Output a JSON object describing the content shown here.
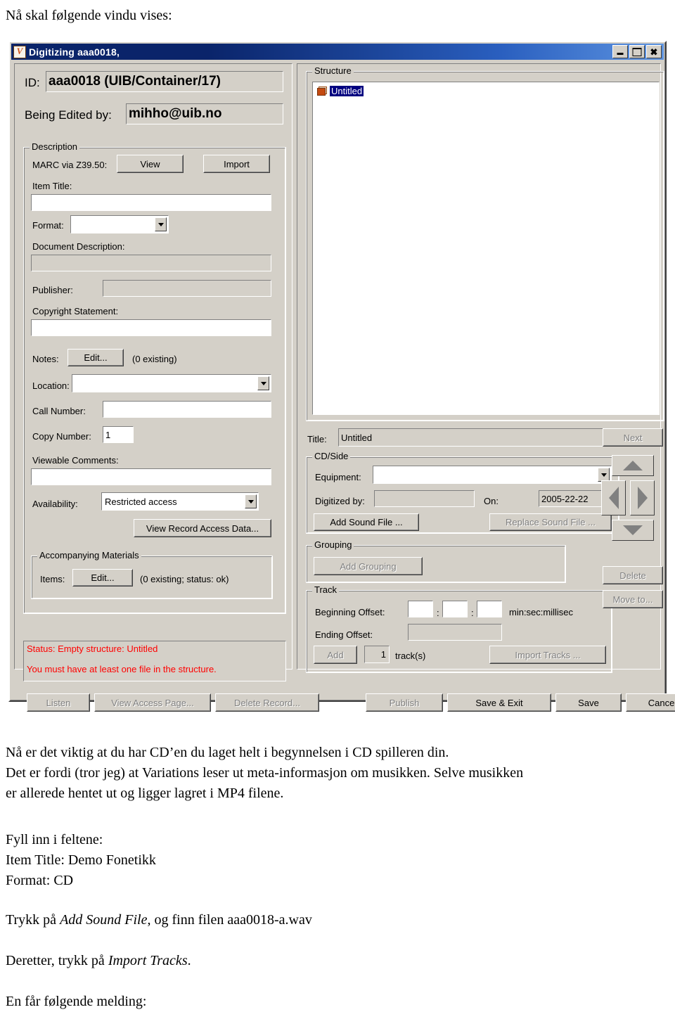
{
  "doc": {
    "intro": "Nå skal følgende vindu vises:",
    "paragraphs": [
      "Nå er det viktig at du har CD’en du laget helt i begynnelsen i CD spilleren din.",
      "Det er fordi (tror jeg) at Variations leser ut meta-informasjon om musikken. Selve musikken",
      "er allerede hentet ut og ligger lagret i MP4 filene."
    ],
    "fill_heading": "Fyll inn i feltene:",
    "fill_item_title": "Item Title: Demo Fonetikk",
    "fill_format": "Format: CD",
    "press_prefix": "Trykk på ",
    "press_emphasis": "Add Sound File",
    "press_suffix": ", og finn filen aaa0018-a.wav",
    "then_prefix": "Deretter, trykk på ",
    "then_emphasis": "Import Tracks",
    "then_suffix": ".",
    "closing": "En får følgende melding:"
  },
  "window": {
    "title": "Digitizing aaa0018,",
    "minimize_glyph": "",
    "maximize_glyph": "",
    "close_glyph": "✖"
  },
  "left": {
    "id_label": "ID:",
    "id_value": "aaa0018 (UIB/Container/17)",
    "edited_by_label": "Being Edited by:",
    "edited_by_value": "mihho@uib.no",
    "description_group": "Description",
    "marc_label": "MARC via Z39.50:",
    "marc_view": "View",
    "marc_import": "Import",
    "item_title_label": "Item Title:",
    "item_title_value": "",
    "format_label": "Format:",
    "format_value": "",
    "doc_desc_label": "Document Description:",
    "doc_desc_value": "",
    "publisher_label": "Publisher:",
    "publisher_value": "",
    "copyright_label": "Copyright Statement:",
    "copyright_value": "",
    "notes_label": "Notes:",
    "notes_edit": "Edit...",
    "notes_count": "(0 existing)",
    "location_label": "Location:",
    "location_value": "",
    "call_number_label": "Call Number:",
    "call_number_value": "",
    "copy_number_label": "Copy Number:",
    "copy_number_value": "1",
    "viewable_comments_label": "Viewable Comments:",
    "viewable_comments_value": "",
    "availability_label": "Availability:",
    "availability_value": "Restricted access",
    "view_record_access": "View Record Access Data...",
    "accompanying_group": "Accompanying Materials",
    "items_label": "Items:",
    "items_edit": "Edit...",
    "items_count": "(0 existing; status: ok)",
    "status_line_1": "Status: Empty structure: Untitled",
    "status_line_2": "You must have at least one file in the structure.",
    "btn_listen": "Listen",
    "btn_view_access_page": "View Access Page...",
    "btn_delete_record": "Delete Record..."
  },
  "right": {
    "structure_group": "Structure",
    "structure_node": "Untitled",
    "title_label": "Title:",
    "title_value": "Untitled",
    "cdside_group": "CD/Side",
    "equipment_label": "Equipment:",
    "equipment_value": "",
    "digitized_by_label": "Digitized by:",
    "digitized_by_value": "",
    "on_label": "On:",
    "on_value": "2005-22-22",
    "add_sound_file": "Add Sound File ...",
    "replace_sound_file": "Replace Sound File ...",
    "grouping_group": "Grouping",
    "add_grouping": "Add Grouping",
    "track_group": "Track",
    "beginning_offset_label": "Beginning Offset:",
    "offset_min": "",
    "offset_sec": "",
    "offset_ms": "",
    "offset_colon_1": ":",
    "offset_colon_2": ":",
    "offset_units": "min:sec:millisec",
    "ending_offset_label": "Ending Offset:",
    "ending_offset_value": "",
    "btn_add": "Add",
    "track_count": "1",
    "tracks_label": "track(s)",
    "import_tracks": "Import Tracks ...",
    "btn_next": "Next",
    "btn_delete": "Delete",
    "btn_move_to": "Move to..."
  },
  "footer": {
    "publish": "Publish",
    "save_exit": "Save & Exit",
    "save": "Save",
    "cancel": "Cancel"
  }
}
